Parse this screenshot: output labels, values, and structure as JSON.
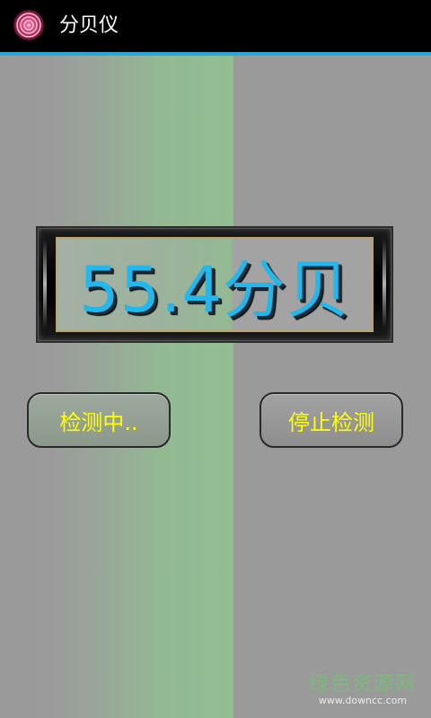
{
  "app": {
    "title": "分贝仪",
    "icon": "app-logo-icon"
  },
  "meter": {
    "reading": "55.4分贝"
  },
  "buttons": {
    "detecting": "检测中..",
    "stop": "停止检测"
  },
  "watermark": {
    "main": "绿色资源网",
    "sub": "www.downcc.com"
  },
  "colors": {
    "titlebar": "#000000",
    "accent_line": "#29a8d8",
    "reading_text": "#22b8ee",
    "button_text": "#ffff00",
    "background": "#9a9a9a",
    "green_band": "#91bd91"
  }
}
